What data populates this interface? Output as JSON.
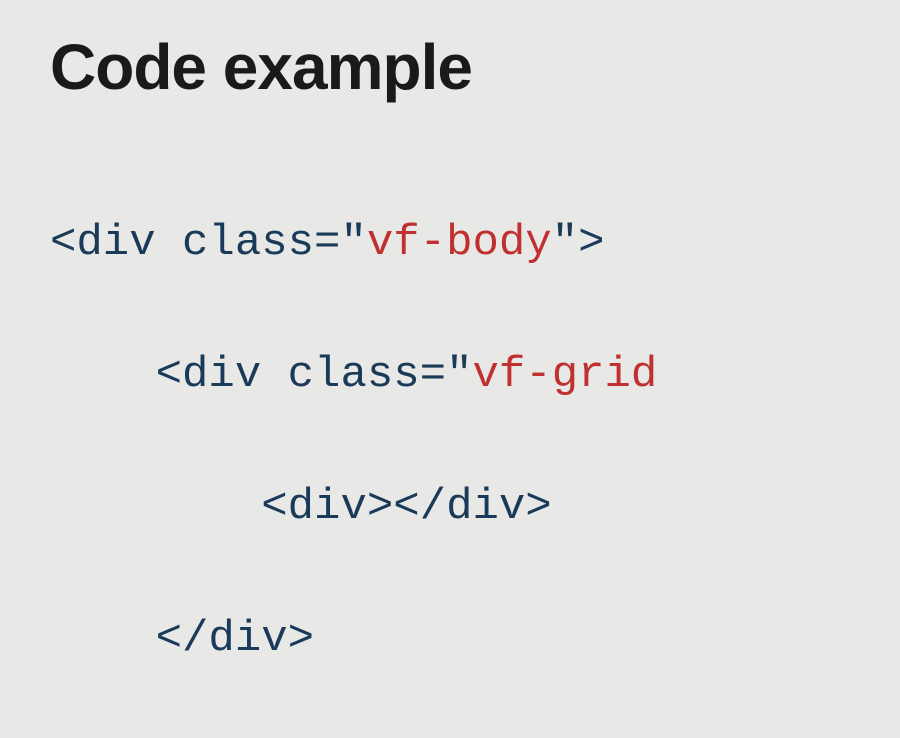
{
  "heading": "Code example",
  "code": {
    "line1": {
      "open": "<div ",
      "attr": "class=",
      "q1": "\"",
      "val": "vf-body",
      "q2": "\"",
      "close": ">"
    },
    "line2": {
      "indent": "    ",
      "open": "<div ",
      "attr": "class=",
      "q1": "\"",
      "val": "vf-grid"
    },
    "line3": {
      "indent": "        ",
      "open": "<div>",
      "close": "</div>"
    },
    "line4": {
      "indent": "    ",
      "close": "</div>"
    }
  }
}
